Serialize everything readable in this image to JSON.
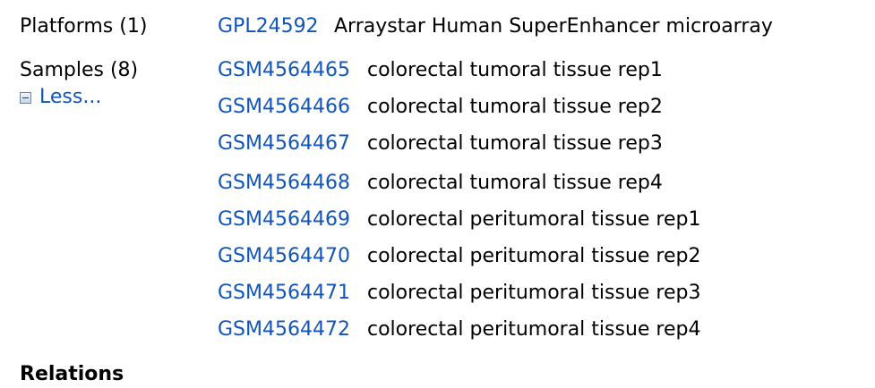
{
  "platforms": {
    "label": "Platforms (1)",
    "items": [
      {
        "accession": "GPL24592",
        "title": "Arraystar Human SuperEnhancer microarray"
      }
    ]
  },
  "samples": {
    "label": "Samples (8)",
    "toggle": {
      "icon": "minus-box-icon",
      "label": "Less..."
    },
    "items": [
      {
        "accession": "GSM4564465",
        "title": "colorectal tumoral tissue rep1"
      },
      {
        "accession": "GSM4564466",
        "title": "colorectal tumoral tissue rep2"
      },
      {
        "accession": "GSM4564467",
        "title": "colorectal tumoral tissue rep3"
      },
      {
        "accession": "GSM4564468",
        "title": "colorectal tumoral tissue rep4"
      },
      {
        "accession": "GSM4564469",
        "title": "colorectal peritumoral tissue rep1"
      },
      {
        "accession": "GSM4564470",
        "title": "colorectal peritumoral tissue rep2"
      },
      {
        "accession": "GSM4564471",
        "title": "colorectal peritumoral tissue rep3"
      },
      {
        "accession": "GSM4564472",
        "title": "colorectal peritumoral tissue rep4"
      }
    ]
  },
  "relations": {
    "heading": "Relations"
  },
  "colors": {
    "link": "#1155bb",
    "text": "#000000"
  }
}
